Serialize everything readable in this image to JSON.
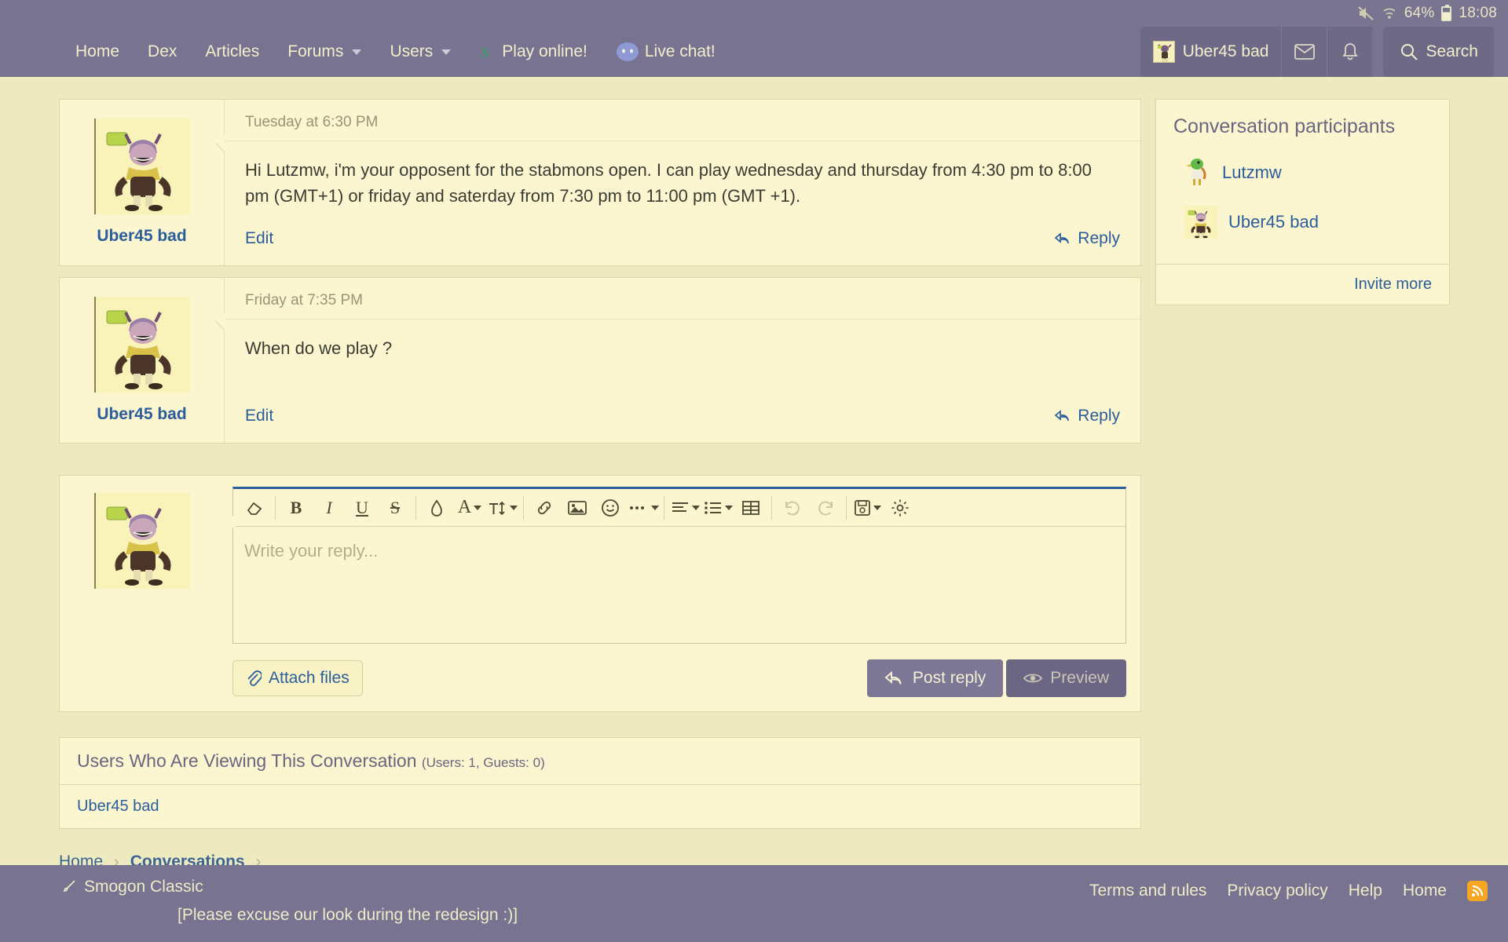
{
  "statusbar": {
    "mute_icon": "mute-icon",
    "wifi_icon": "wifi-icon",
    "battery_percent": "64%",
    "clock": "18:08"
  },
  "nav": {
    "items": [
      {
        "label": "Home",
        "has_caret": false
      },
      {
        "label": "Dex",
        "has_caret": false
      },
      {
        "label": "Articles",
        "has_caret": false
      },
      {
        "label": "Forums",
        "has_caret": true
      },
      {
        "label": "Users",
        "has_caret": true
      },
      {
        "label": "Play online!",
        "has_caret": false,
        "icon": "smogon-s-icon"
      },
      {
        "label": "Live chat!",
        "has_caret": false,
        "icon": "discord-icon"
      }
    ],
    "user": "Uber45 bad",
    "inbox_icon": "envelope-icon",
    "alerts_icon": "bell-icon",
    "search_label": "Search",
    "search_icon": "search-icon"
  },
  "messages": [
    {
      "username": "Uber45 bad",
      "time": "Tuesday at 6:30 PM",
      "text": "Hi Lutzmw, i'm your opposent for the stabmons open. I can play wednesday and thursday from 4:30 pm to 8:00 pm (GMT+1) or friday and saterday from 7:30 pm to 11:00 pm (GMT +1).",
      "edit_label": "Edit",
      "reply_label": "Reply"
    },
    {
      "username": "Uber45 bad",
      "time": "Friday at 7:35 PM",
      "text": "When do we play ?",
      "edit_label": "Edit",
      "reply_label": "Reply"
    }
  ],
  "editor": {
    "placeholder": "Write your reply...",
    "attach_label": "Attach files",
    "post_label": "Post reply",
    "preview_label": "Preview",
    "toolbar": [
      {
        "name": "remove-formatting-icon",
        "glyph": "◇"
      },
      {
        "name": "bold-icon",
        "glyph": "B"
      },
      {
        "name": "italic-icon",
        "glyph": "I"
      },
      {
        "name": "underline-icon",
        "glyph": "U"
      },
      {
        "name": "strikethrough-icon",
        "glyph": "S"
      },
      {
        "name": "text-color-icon",
        "glyph": "○"
      },
      {
        "name": "font-family-icon",
        "glyph": "A"
      },
      {
        "name": "font-size-icon",
        "glyph": "T"
      },
      {
        "name": "link-icon",
        "glyph": "⚭"
      },
      {
        "name": "image-icon",
        "glyph": "Ὓc"
      },
      {
        "name": "smilies-icon",
        "glyph": "☺"
      },
      {
        "name": "more-options-icon",
        "glyph": "···"
      },
      {
        "name": "align-icon",
        "glyph": "≡"
      },
      {
        "name": "list-icon",
        "glyph": "≔"
      },
      {
        "name": "table-icon",
        "glyph": "⊞"
      },
      {
        "name": "undo-icon",
        "glyph": "↶"
      },
      {
        "name": "redo-icon",
        "glyph": "↷"
      },
      {
        "name": "draft-icon",
        "glyph": "Ὃe"
      },
      {
        "name": "settings-gear-icon",
        "glyph": "⚙"
      }
    ]
  },
  "participants_panel": {
    "title": "Conversation participants",
    "members": [
      {
        "name": "Lutzmw",
        "avatar": "bird-avatar"
      },
      {
        "name": "Uber45 bad",
        "avatar": "jester-avatar"
      }
    ],
    "invite_label": "Invite more"
  },
  "viewing": {
    "title": "Users Who Are Viewing This Conversation",
    "counts": "(Users: 1, Guests: 0)",
    "users": [
      "Uber45 bad"
    ]
  },
  "breadcrumb": [
    {
      "label": "Home",
      "active": false
    },
    {
      "label": "Conversations",
      "active": true
    }
  ],
  "footer": {
    "style_label": "Smogon Classic",
    "style_icon": "paintbrush-icon",
    "notice": "[Please excuse our look during the redesign :)]",
    "links": [
      "Terms and rules",
      "Privacy policy",
      "Help",
      "Home"
    ],
    "rss_icon": "rss-icon"
  },
  "colors": {
    "nav_bg": "#787390",
    "page_bg": "#eeeac0",
    "panel_bg": "#fbf6d0",
    "link": "#2b5d9b",
    "accent_button": "#7c7794",
    "rss_orange": "#f5a623"
  }
}
